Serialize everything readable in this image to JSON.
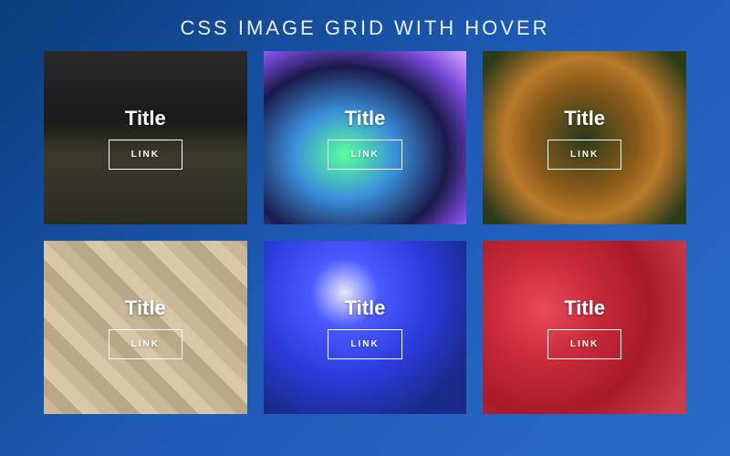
{
  "page_title": "CSS IMAGE GRID WITH HOVER",
  "cards": [
    {
      "title": "Title",
      "link_label": "LINK",
      "image_subject": "escalator-architecture"
    },
    {
      "title": "Title",
      "link_label": "LINK",
      "image_subject": "earth-aurora-space"
    },
    {
      "title": "Title",
      "link_label": "LINK",
      "image_subject": "forest-aerial-autumn"
    },
    {
      "title": "Title",
      "link_label": "LINK",
      "image_subject": "open-books-pile"
    },
    {
      "title": "Title",
      "link_label": "LINK",
      "image_subject": "blue-crater-terrain"
    },
    {
      "title": "Title",
      "link_label": "LINK",
      "image_subject": "strawberries-closeup"
    }
  ]
}
